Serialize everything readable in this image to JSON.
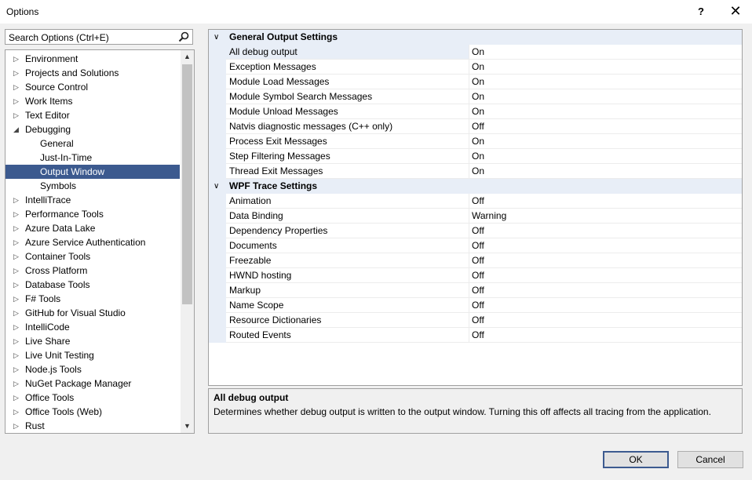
{
  "window": {
    "title": "Options",
    "help_label": "?",
    "close_label": "✕"
  },
  "search": {
    "placeholder": "Search Options (Ctrl+E)"
  },
  "tree": {
    "items": [
      {
        "label": "Environment",
        "arrow": "▷",
        "level": 0
      },
      {
        "label": "Projects and Solutions",
        "arrow": "▷",
        "level": 0
      },
      {
        "label": "Source Control",
        "arrow": "▷",
        "level": 0
      },
      {
        "label": "Work Items",
        "arrow": "▷",
        "level": 0
      },
      {
        "label": "Text Editor",
        "arrow": "▷",
        "level": 0
      },
      {
        "label": "Debugging",
        "arrow": "◢",
        "level": 0
      },
      {
        "label": "General",
        "arrow": "",
        "level": 1
      },
      {
        "label": "Just-In-Time",
        "arrow": "",
        "level": 1
      },
      {
        "label": "Output Window",
        "arrow": "",
        "level": 1,
        "selected": true
      },
      {
        "label": "Symbols",
        "arrow": "",
        "level": 1
      },
      {
        "label": "IntelliTrace",
        "arrow": "▷",
        "level": 0
      },
      {
        "label": "Performance Tools",
        "arrow": "▷",
        "level": 0
      },
      {
        "label": "Azure Data Lake",
        "arrow": "▷",
        "level": 0
      },
      {
        "label": "Azure Service Authentication",
        "arrow": "▷",
        "level": 0
      },
      {
        "label": "Container Tools",
        "arrow": "▷",
        "level": 0
      },
      {
        "label": "Cross Platform",
        "arrow": "▷",
        "level": 0
      },
      {
        "label": "Database Tools",
        "arrow": "▷",
        "level": 0
      },
      {
        "label": "F# Tools",
        "arrow": "▷",
        "level": 0
      },
      {
        "label": "GitHub for Visual Studio",
        "arrow": "▷",
        "level": 0
      },
      {
        "label": "IntelliCode",
        "arrow": "▷",
        "level": 0
      },
      {
        "label": "Live Share",
        "arrow": "▷",
        "level": 0
      },
      {
        "label": "Live Unit Testing",
        "arrow": "▷",
        "level": 0
      },
      {
        "label": "Node.js Tools",
        "arrow": "▷",
        "level": 0
      },
      {
        "label": "NuGet Package Manager",
        "arrow": "▷",
        "level": 0
      },
      {
        "label": "Office Tools",
        "arrow": "▷",
        "level": 0
      },
      {
        "label": "Office Tools (Web)",
        "arrow": "▷",
        "level": 0
      },
      {
        "label": "Rust",
        "arrow": "▷",
        "level": 0
      }
    ]
  },
  "grid": {
    "categories": [
      {
        "title": "General Output Settings",
        "rows": [
          {
            "name": "All debug output",
            "value": "On",
            "selected": true
          },
          {
            "name": "Exception Messages",
            "value": "On"
          },
          {
            "name": "Module Load Messages",
            "value": "On"
          },
          {
            "name": "Module Symbol Search Messages",
            "value": "On"
          },
          {
            "name": "Module Unload Messages",
            "value": "On"
          },
          {
            "name": "Natvis diagnostic messages (C++ only)",
            "value": "Off"
          },
          {
            "name": "Process Exit Messages",
            "value": "On"
          },
          {
            "name": "Step Filtering Messages",
            "value": "On"
          },
          {
            "name": "Thread Exit Messages",
            "value": "On"
          }
        ]
      },
      {
        "title": "WPF Trace Settings",
        "rows": [
          {
            "name": "Animation",
            "value": "Off"
          },
          {
            "name": "Data Binding",
            "value": "Warning"
          },
          {
            "name": "Dependency Properties",
            "value": "Off"
          },
          {
            "name": "Documents",
            "value": "Off"
          },
          {
            "name": "Freezable",
            "value": "Off"
          },
          {
            "name": "HWND hosting",
            "value": "Off"
          },
          {
            "name": "Markup",
            "value": "Off"
          },
          {
            "name": "Name Scope",
            "value": "Off"
          },
          {
            "name": "Resource Dictionaries",
            "value": "Off"
          },
          {
            "name": "Routed Events",
            "value": "Off"
          }
        ]
      }
    ]
  },
  "description": {
    "title": "All debug output",
    "text": "Determines whether debug output is written to the output window. Turning this off affects all tracing from the application."
  },
  "buttons": {
    "ok": "OK",
    "cancel": "Cancel"
  },
  "colors": {
    "selection": "#3c5a8f",
    "category_bg": "#e8eef7"
  }
}
